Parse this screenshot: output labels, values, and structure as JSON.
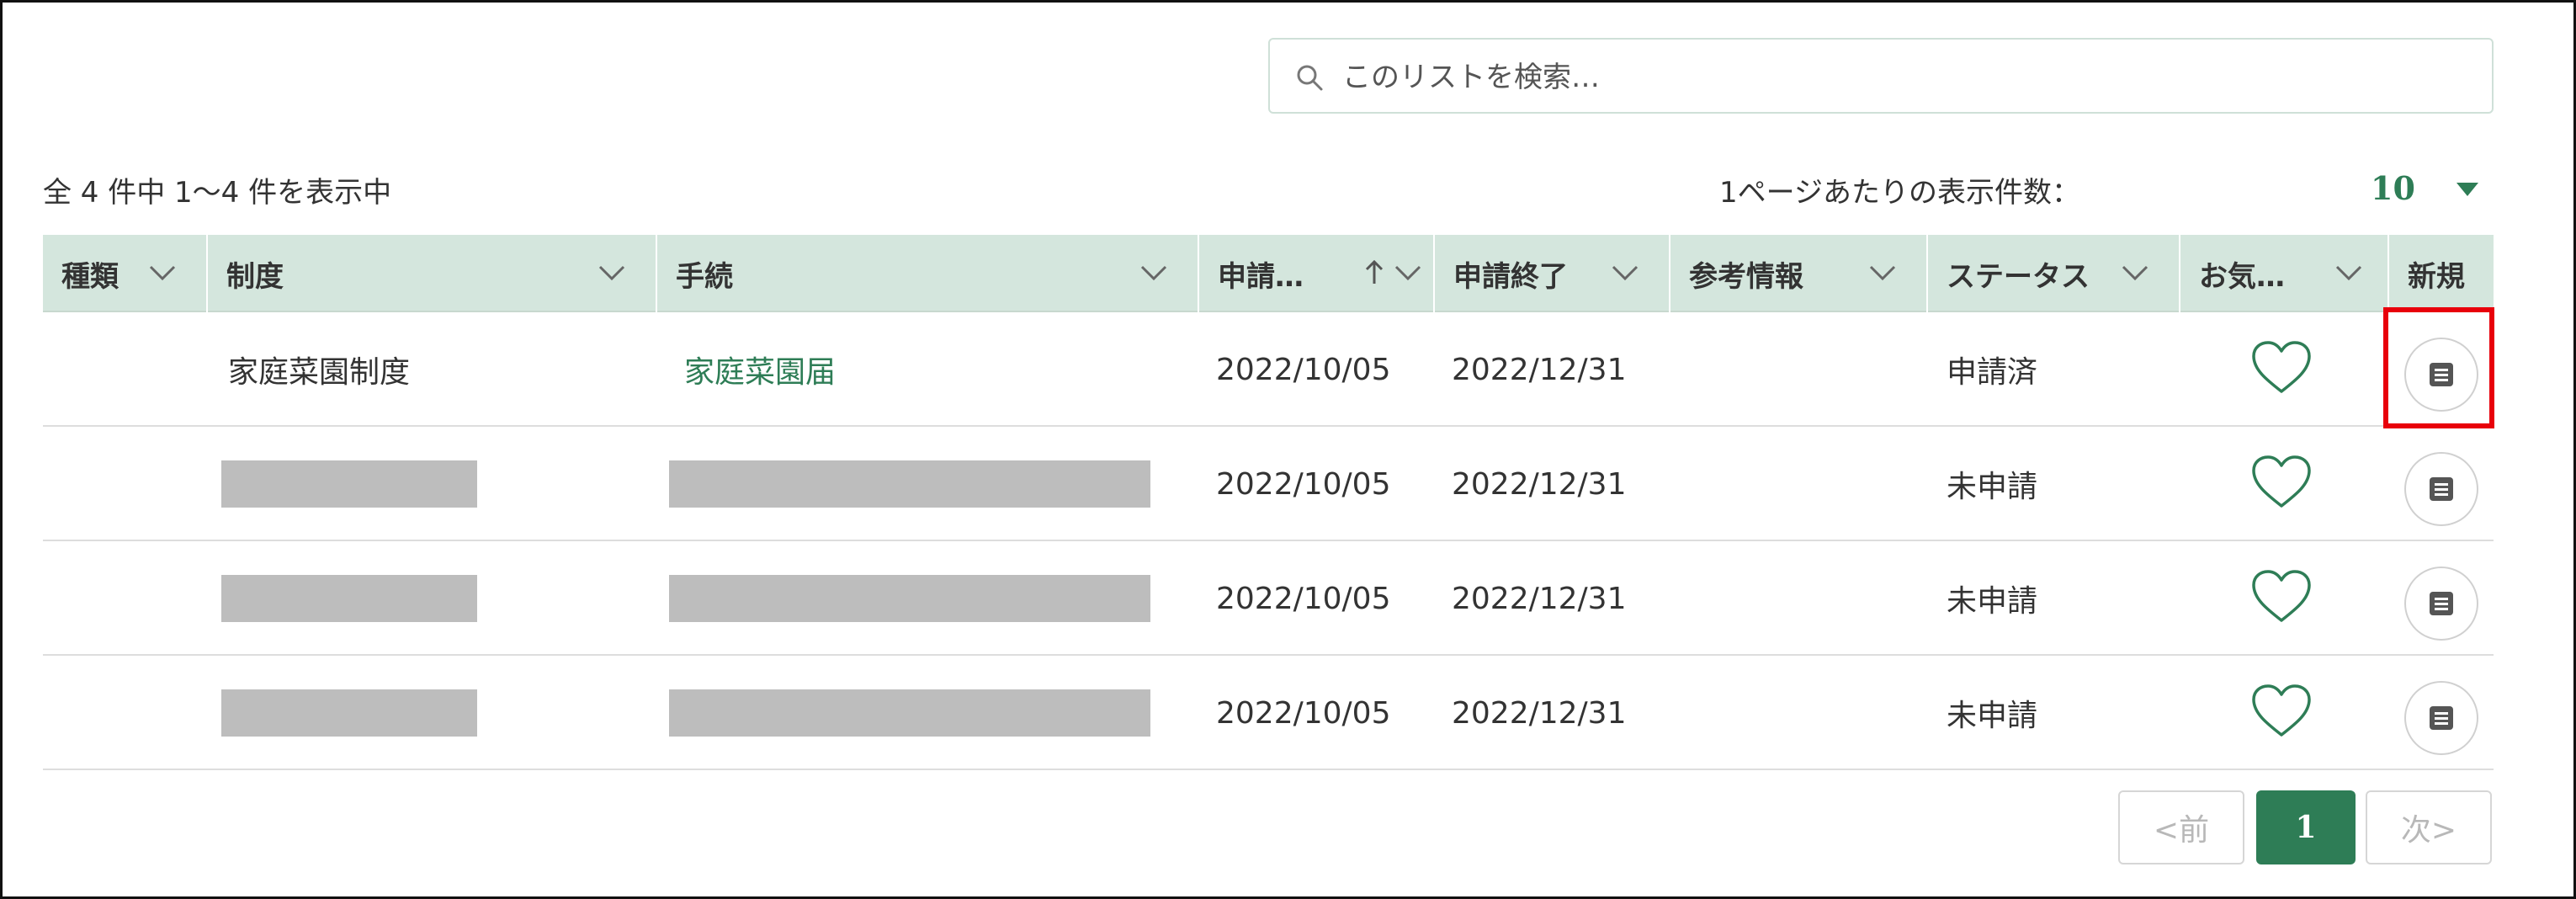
{
  "search": {
    "placeholder": "このリストを検索…"
  },
  "summary": {
    "count_text": "全 4 件中 1～4 件を表示中",
    "per_page_label": "1ページあたりの表示件数：",
    "per_page_value": "10"
  },
  "table": {
    "headers": {
      "kind": "種類",
      "system": "制度",
      "procedure": "手続",
      "start": "申請…",
      "end": "申請終了",
      "reference": "参考情報",
      "status": "ステータス",
      "favorite": "お気…",
      "new": "新規"
    },
    "rows": [
      {
        "system": "家庭菜園制度",
        "procedure": "家庭菜園届",
        "start": "2022/10/05",
        "end": "2022/12/31",
        "status": "申請済"
      },
      {
        "system": "",
        "procedure": "",
        "start": "2022/10/05",
        "end": "2022/12/31",
        "status": "未申請"
      },
      {
        "system": "",
        "procedure": "",
        "start": "2022/10/05",
        "end": "2022/12/31",
        "status": "未申請"
      },
      {
        "system": "",
        "procedure": "",
        "start": "2022/10/05",
        "end": "2022/12/31",
        "status": "未申請"
      }
    ]
  },
  "pagination": {
    "prev": "<前",
    "current": "1",
    "next": "次>"
  },
  "colors": {
    "accent": "#2e7d56",
    "header_bg": "#d4e6dd",
    "highlight": "#e8000b",
    "redaction": "#bdbdbd"
  },
  "icons": {
    "search": "search-icon",
    "sort_toggle": "chevron-down-icon",
    "sort_asc": "arrow-up-icon",
    "favorite": "heart-outline-icon",
    "new_application": "document-icon",
    "per_page_toggle": "triangle-down-icon"
  }
}
